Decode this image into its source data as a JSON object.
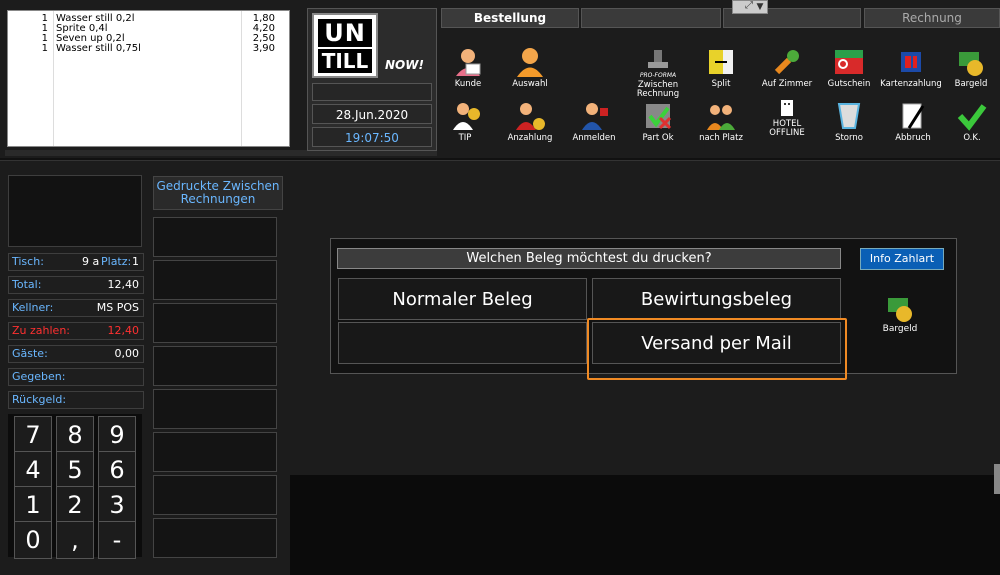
{
  "order_items": [
    {
      "qty": "1",
      "name": "Wasser still 0,2l",
      "price": "1,80"
    },
    {
      "qty": "1",
      "name": "Sprite 0,4l",
      "price": "4,20"
    },
    {
      "qty": "1",
      "name": "Seven up 0,2l",
      "price": "2,50"
    },
    {
      "qty": "1",
      "name": "Wasser still 0,75l",
      "price": "3,90"
    }
  ],
  "logo": {
    "un": "UN",
    "till": "TILL",
    "now": "NOW!"
  },
  "date": "28.Jun.2020",
  "time": "19:07:50",
  "tabs": {
    "bestellung": "Bestellung",
    "rechnung": "Rechnung"
  },
  "toolbar_row1": [
    "Kunde",
    "Auswahl",
    "Zwischen Rechnung",
    "Split",
    "Auf Zimmer",
    "Gutschein",
    "Kartenzahlung",
    "Bargeld"
  ],
  "toolbar_row2": [
    "TIP",
    "Anzahlung",
    "Anmelden",
    "Part Ok",
    "nach Platz",
    "HOTEL OFFLINE",
    "Storno",
    "Abbruch",
    "O.K."
  ],
  "pro_forma": "PRO-FORMA",
  "info": {
    "tisch_label": "Tisch:",
    "tisch_value": "9 a",
    "platz_label": "Platz:",
    "platz_value": "1",
    "total_label": "Total:",
    "total_value": "12,40",
    "kellner_label": "Kellner:",
    "kellner_value": "MS POS",
    "zu_zahlen_label": "Zu zahlen:",
    "zu_zahlen_value": "12,40",
    "gaeste_label": "Gäste:",
    "gaeste_value": "0,00",
    "gegeben_label": "Gegeben:",
    "rueckgeld_label": "Rückgeld:"
  },
  "keypad": [
    "7",
    "8",
    "9",
    "4",
    "5",
    "6",
    "1",
    "2",
    "3",
    "0",
    ",",
    "-"
  ],
  "printed_title": "Gedruckte Zwischen Rechnungen",
  "dialog": {
    "question": "Welchen Beleg möchtest du drucken?",
    "info_button": "Info Zahlart",
    "normal": "Normaler Beleg",
    "bewirtung": "Bewirtungsbeleg",
    "mail": "Versand per Mail",
    "bargeld": "Bargeld"
  },
  "colors": {
    "accent_blue": "#6ab7ff",
    "alert_red": "#ff3030",
    "highlight_orange": "#f08a24",
    "info_button": "#0a5fb5"
  }
}
